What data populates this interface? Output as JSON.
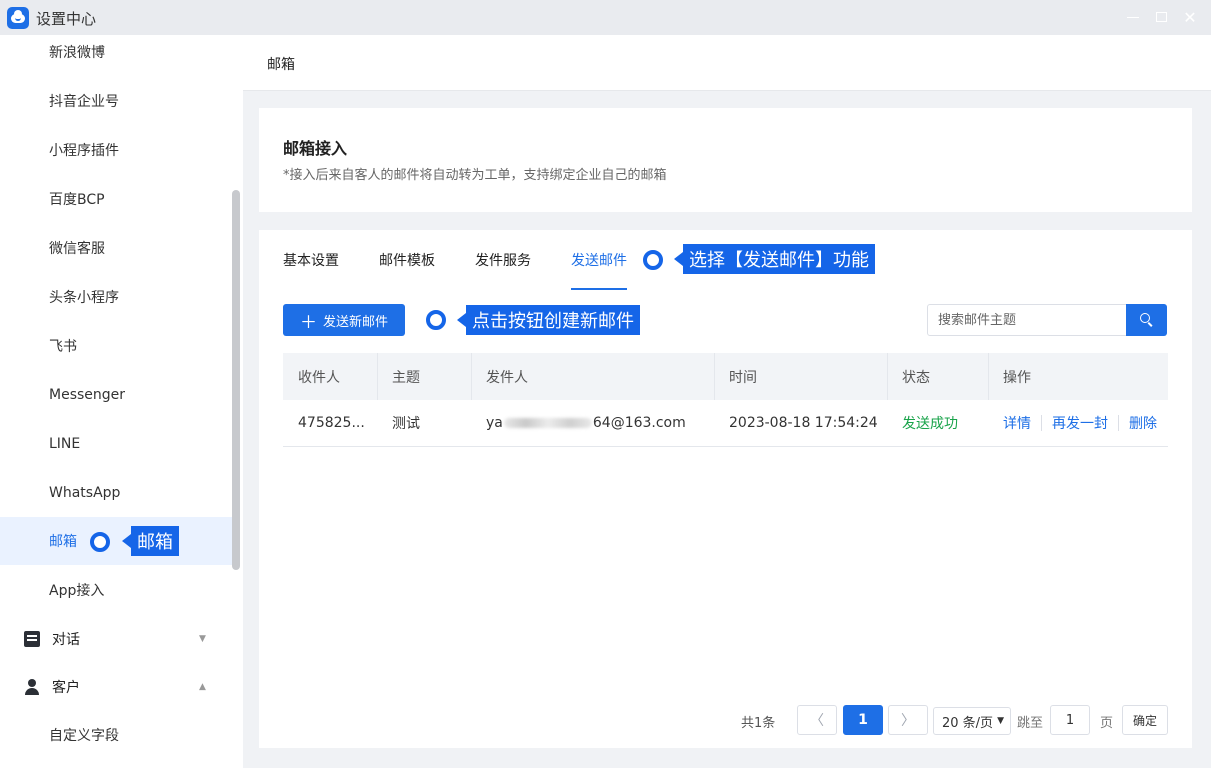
{
  "window": {
    "title": "设置中心"
  },
  "sidebar": {
    "items": [
      {
        "label": "新浪微博"
      },
      {
        "label": "抖音企业号"
      },
      {
        "label": "小程序插件"
      },
      {
        "label": "百度BCP"
      },
      {
        "label": "微信客服"
      },
      {
        "label": "头条小程序"
      },
      {
        "label": "飞书"
      },
      {
        "label": "Messenger"
      },
      {
        "label": "LINE"
      },
      {
        "label": "WhatsApp"
      },
      {
        "label": "邮箱",
        "active": true
      },
      {
        "label": "App接入"
      }
    ],
    "groups": [
      {
        "label": "对话",
        "icon": "chat-icon",
        "expanded": false
      },
      {
        "label": "客户",
        "icon": "user-icon",
        "expanded": true
      }
    ],
    "sub_items": [
      {
        "label": "自定义字段"
      }
    ]
  },
  "header": {
    "title": "邮箱"
  },
  "intro": {
    "title": "邮箱接入",
    "description": "*接入后来自客人的邮件将自动转为工单，支持绑定企业自己的邮箱"
  },
  "tabs": [
    {
      "label": "基本设置"
    },
    {
      "label": "邮件模板"
    },
    {
      "label": "发件服务"
    },
    {
      "label": "发送邮件",
      "active": true
    }
  ],
  "toolbar": {
    "new_button": "发送新邮件",
    "new_icon": "plus-icon",
    "search_placeholder": "搜索邮件主题",
    "search_icon": "search-icon"
  },
  "annotations": {
    "tab": "选择【发送邮件】功能",
    "button": "点击按钮创建新邮件",
    "sidebar": "邮箱"
  },
  "table": {
    "columns": [
      "收件人",
      "主题",
      "发件人",
      "时间",
      "状态",
      "操作"
    ],
    "rows": [
      {
        "recipient": "475825...",
        "subject": "测试",
        "sender_prefix": "ya",
        "sender_suffix": "64@163.com",
        "time": "2023-08-18 17:54:24",
        "status": "发送成功",
        "actions": [
          "详情",
          "再发一封",
          "删除"
        ]
      }
    ]
  },
  "pagination": {
    "total": "共1条",
    "current_page": "1",
    "page_size": "20 条/页",
    "jump_label": "跳至",
    "jump_value": "1",
    "page_unit": "页",
    "confirm": "确定"
  },
  "colors": {
    "accent": "#1e6fe6",
    "annotation": "#1565e8",
    "success": "#19a34a"
  }
}
